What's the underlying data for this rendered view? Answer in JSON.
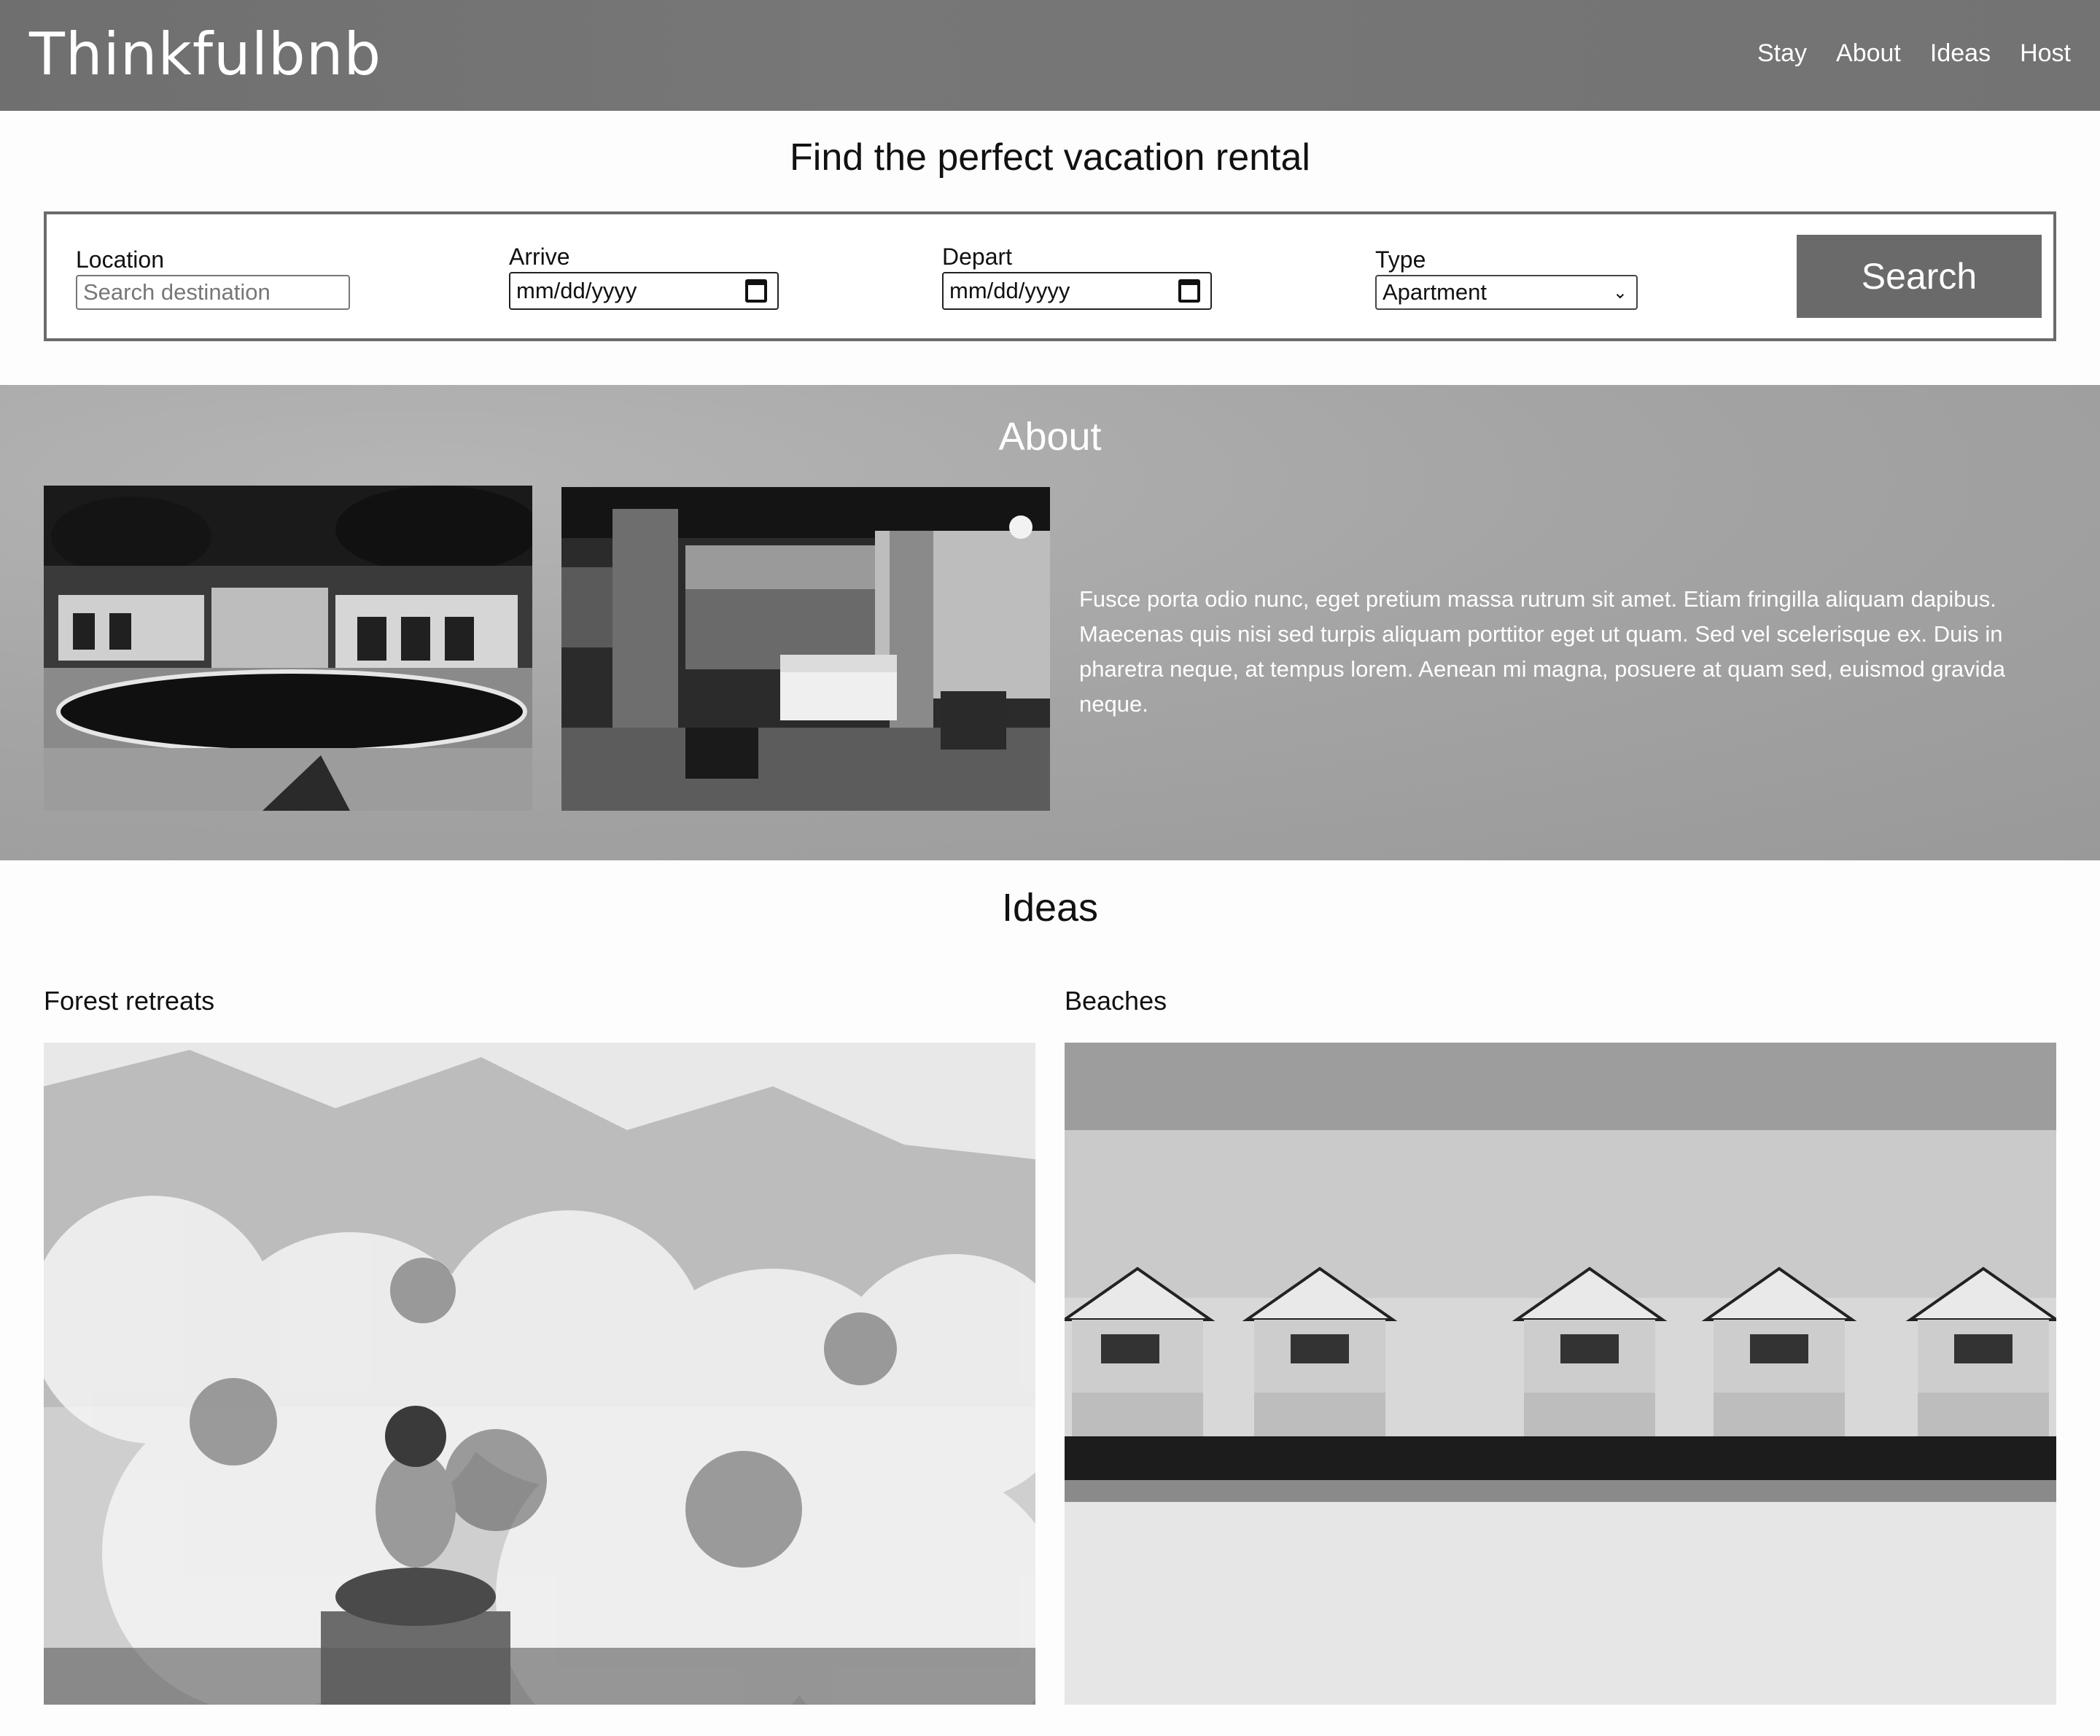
{
  "header": {
    "logo": "Thinkfulbnb",
    "nav": [
      "Stay",
      "About",
      "Ideas",
      "Host"
    ]
  },
  "hero": {
    "title": "Find the perfect vacation rental",
    "location_label": "Location",
    "location_placeholder": "Search destination",
    "arrive_label": "Arrive",
    "arrive_value": "mm/dd/yyyy",
    "depart_label": "Depart",
    "depart_value": "mm/dd/yyyy",
    "type_label": "Type",
    "type_value": "Apartment",
    "search_button": "Search"
  },
  "about": {
    "title": "About",
    "text": "Fusce porta odio nunc, eget pretium massa rutrum sit amet. Etiam fringilla aliquam dapibus. Maecenas quis nisi sed turpis aliquam porttitor eget ut quam. Sed vel scelerisque ex. Duis in pharetra neque, at tempus lorem. Aenean mi magna, posuere at quam sed, euismod gravida neque."
  },
  "ideas": {
    "title": "Ideas",
    "items": [
      {
        "label": "Forest retreats"
      },
      {
        "label": "Beaches"
      }
    ]
  }
}
